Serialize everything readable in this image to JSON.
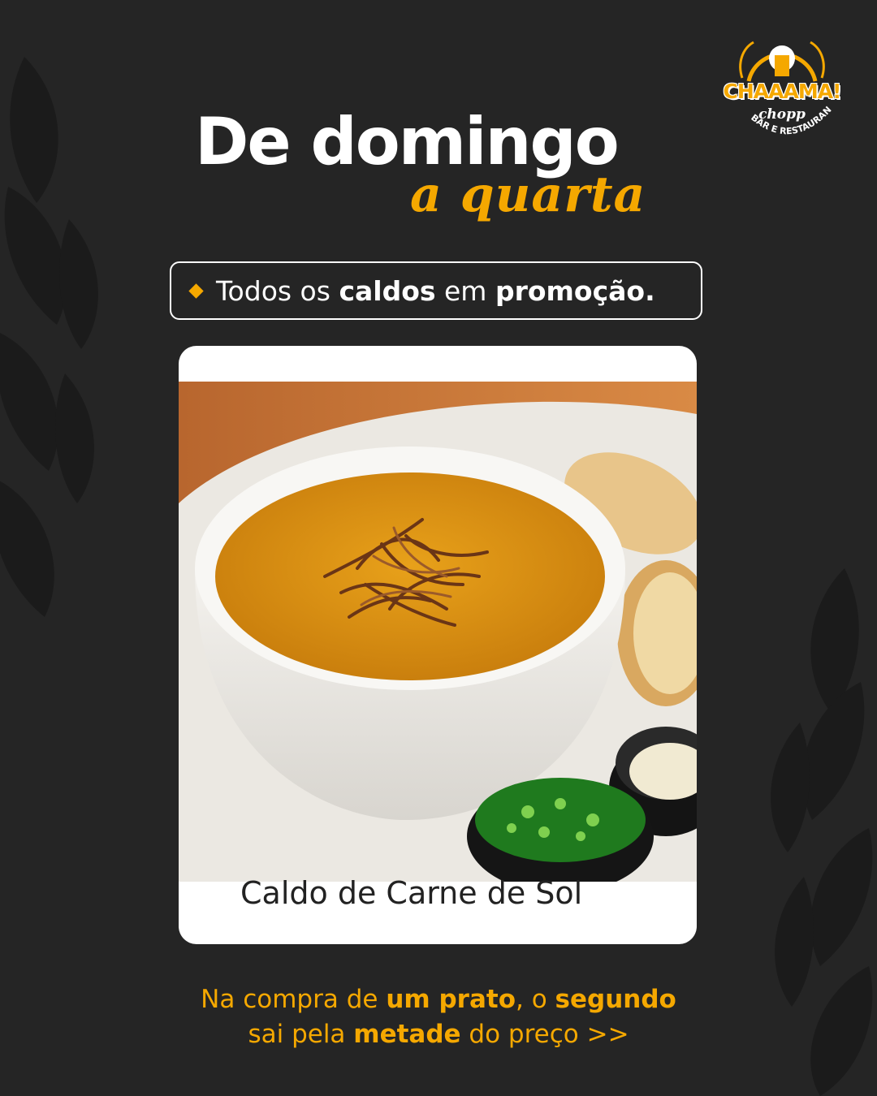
{
  "logo": {
    "brand": "CHAAAMA!",
    "sub": "chopp",
    "tagline": "BAR E RESTAURANTE"
  },
  "headline": {
    "line1": "De domingo",
    "line2": "a quarta"
  },
  "promo": {
    "prefix": "Todos os ",
    "bold1": "caldos",
    "middle": " em ",
    "bold2": "promoção."
  },
  "card": {
    "caption": "Caldo de Carne de Sol"
  },
  "footer": {
    "line1_a": "Na compra de ",
    "line1_b": "um prato",
    "line1_c": ", o ",
    "line1_d": "segundo",
    "line2_a": "sai pela ",
    "line2_b": "metade",
    "line2_c": " do preço >>"
  },
  "colors": {
    "background": "#252525",
    "accent": "#f5a800",
    "text": "#ffffff"
  }
}
